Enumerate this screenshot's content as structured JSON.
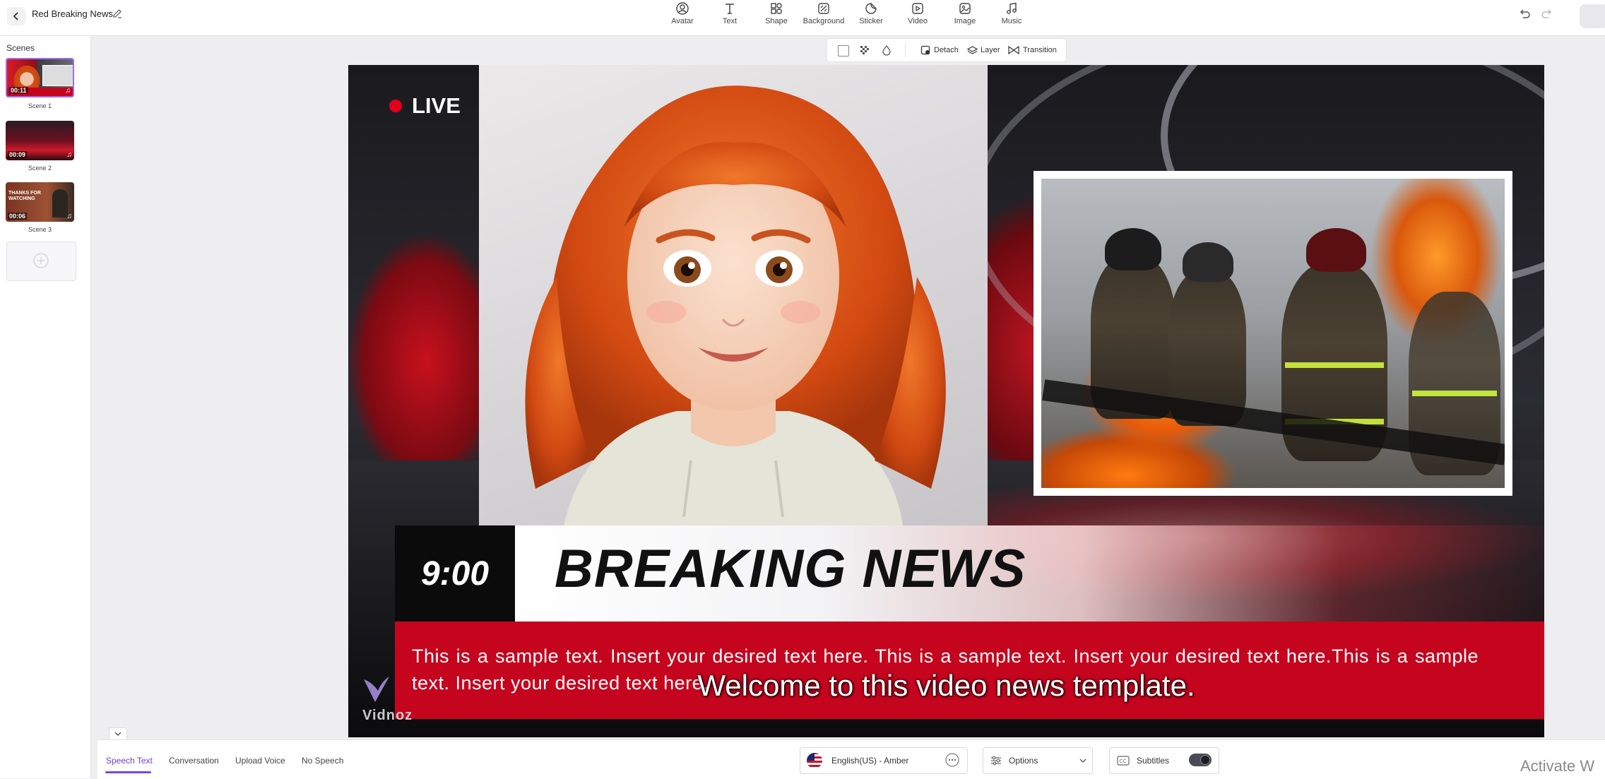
{
  "header": {
    "project_title": "Red Breaking News",
    "tools": [
      {
        "label": "Avatar",
        "icon": "avatar-icon"
      },
      {
        "label": "Text",
        "icon": "text-icon"
      },
      {
        "label": "Shape",
        "icon": "shape-icon"
      },
      {
        "label": "Background",
        "icon": "background-icon"
      },
      {
        "label": "Sticker",
        "icon": "sticker-icon"
      },
      {
        "label": "Video",
        "icon": "video-icon"
      },
      {
        "label": "Image",
        "icon": "image-icon"
      },
      {
        "label": "Music",
        "icon": "music-icon"
      }
    ]
  },
  "scenes": {
    "label": "Scenes",
    "items": [
      {
        "label": "Scene 1",
        "duration": "00:11",
        "selected": true
      },
      {
        "label": "Scene 2",
        "duration": "00:09",
        "selected": false
      },
      {
        "label": "Scene 3",
        "duration": "00:06",
        "selected": false,
        "thumb_text": "THANKS FOR WATCHING"
      }
    ]
  },
  "context_toolbar": {
    "detach": "Detach",
    "layer": "Layer",
    "transition": "Transition"
  },
  "canvas": {
    "live": "LIVE",
    "time": "9:00",
    "headline": "BREAKING NEWS",
    "ticker": "This is a sample text. Insert your desired text here. This is a sample text. Insert your desired text here.This is a sample text. Insert your desired text here.",
    "subtitle": "Welcome to this video news template.",
    "watermark": "Vidnoz",
    "accent_red": "#c5041e"
  },
  "bottom": {
    "tabs": [
      "Speech Text",
      "Conversation",
      "Upload Voice",
      "No Speech"
    ],
    "active_tab": "Speech Text",
    "voice": "English(US) - Amber",
    "options": "Options",
    "subtitles": "Subtitles",
    "subtitles_on": true
  },
  "os_watermark": "Activate W"
}
